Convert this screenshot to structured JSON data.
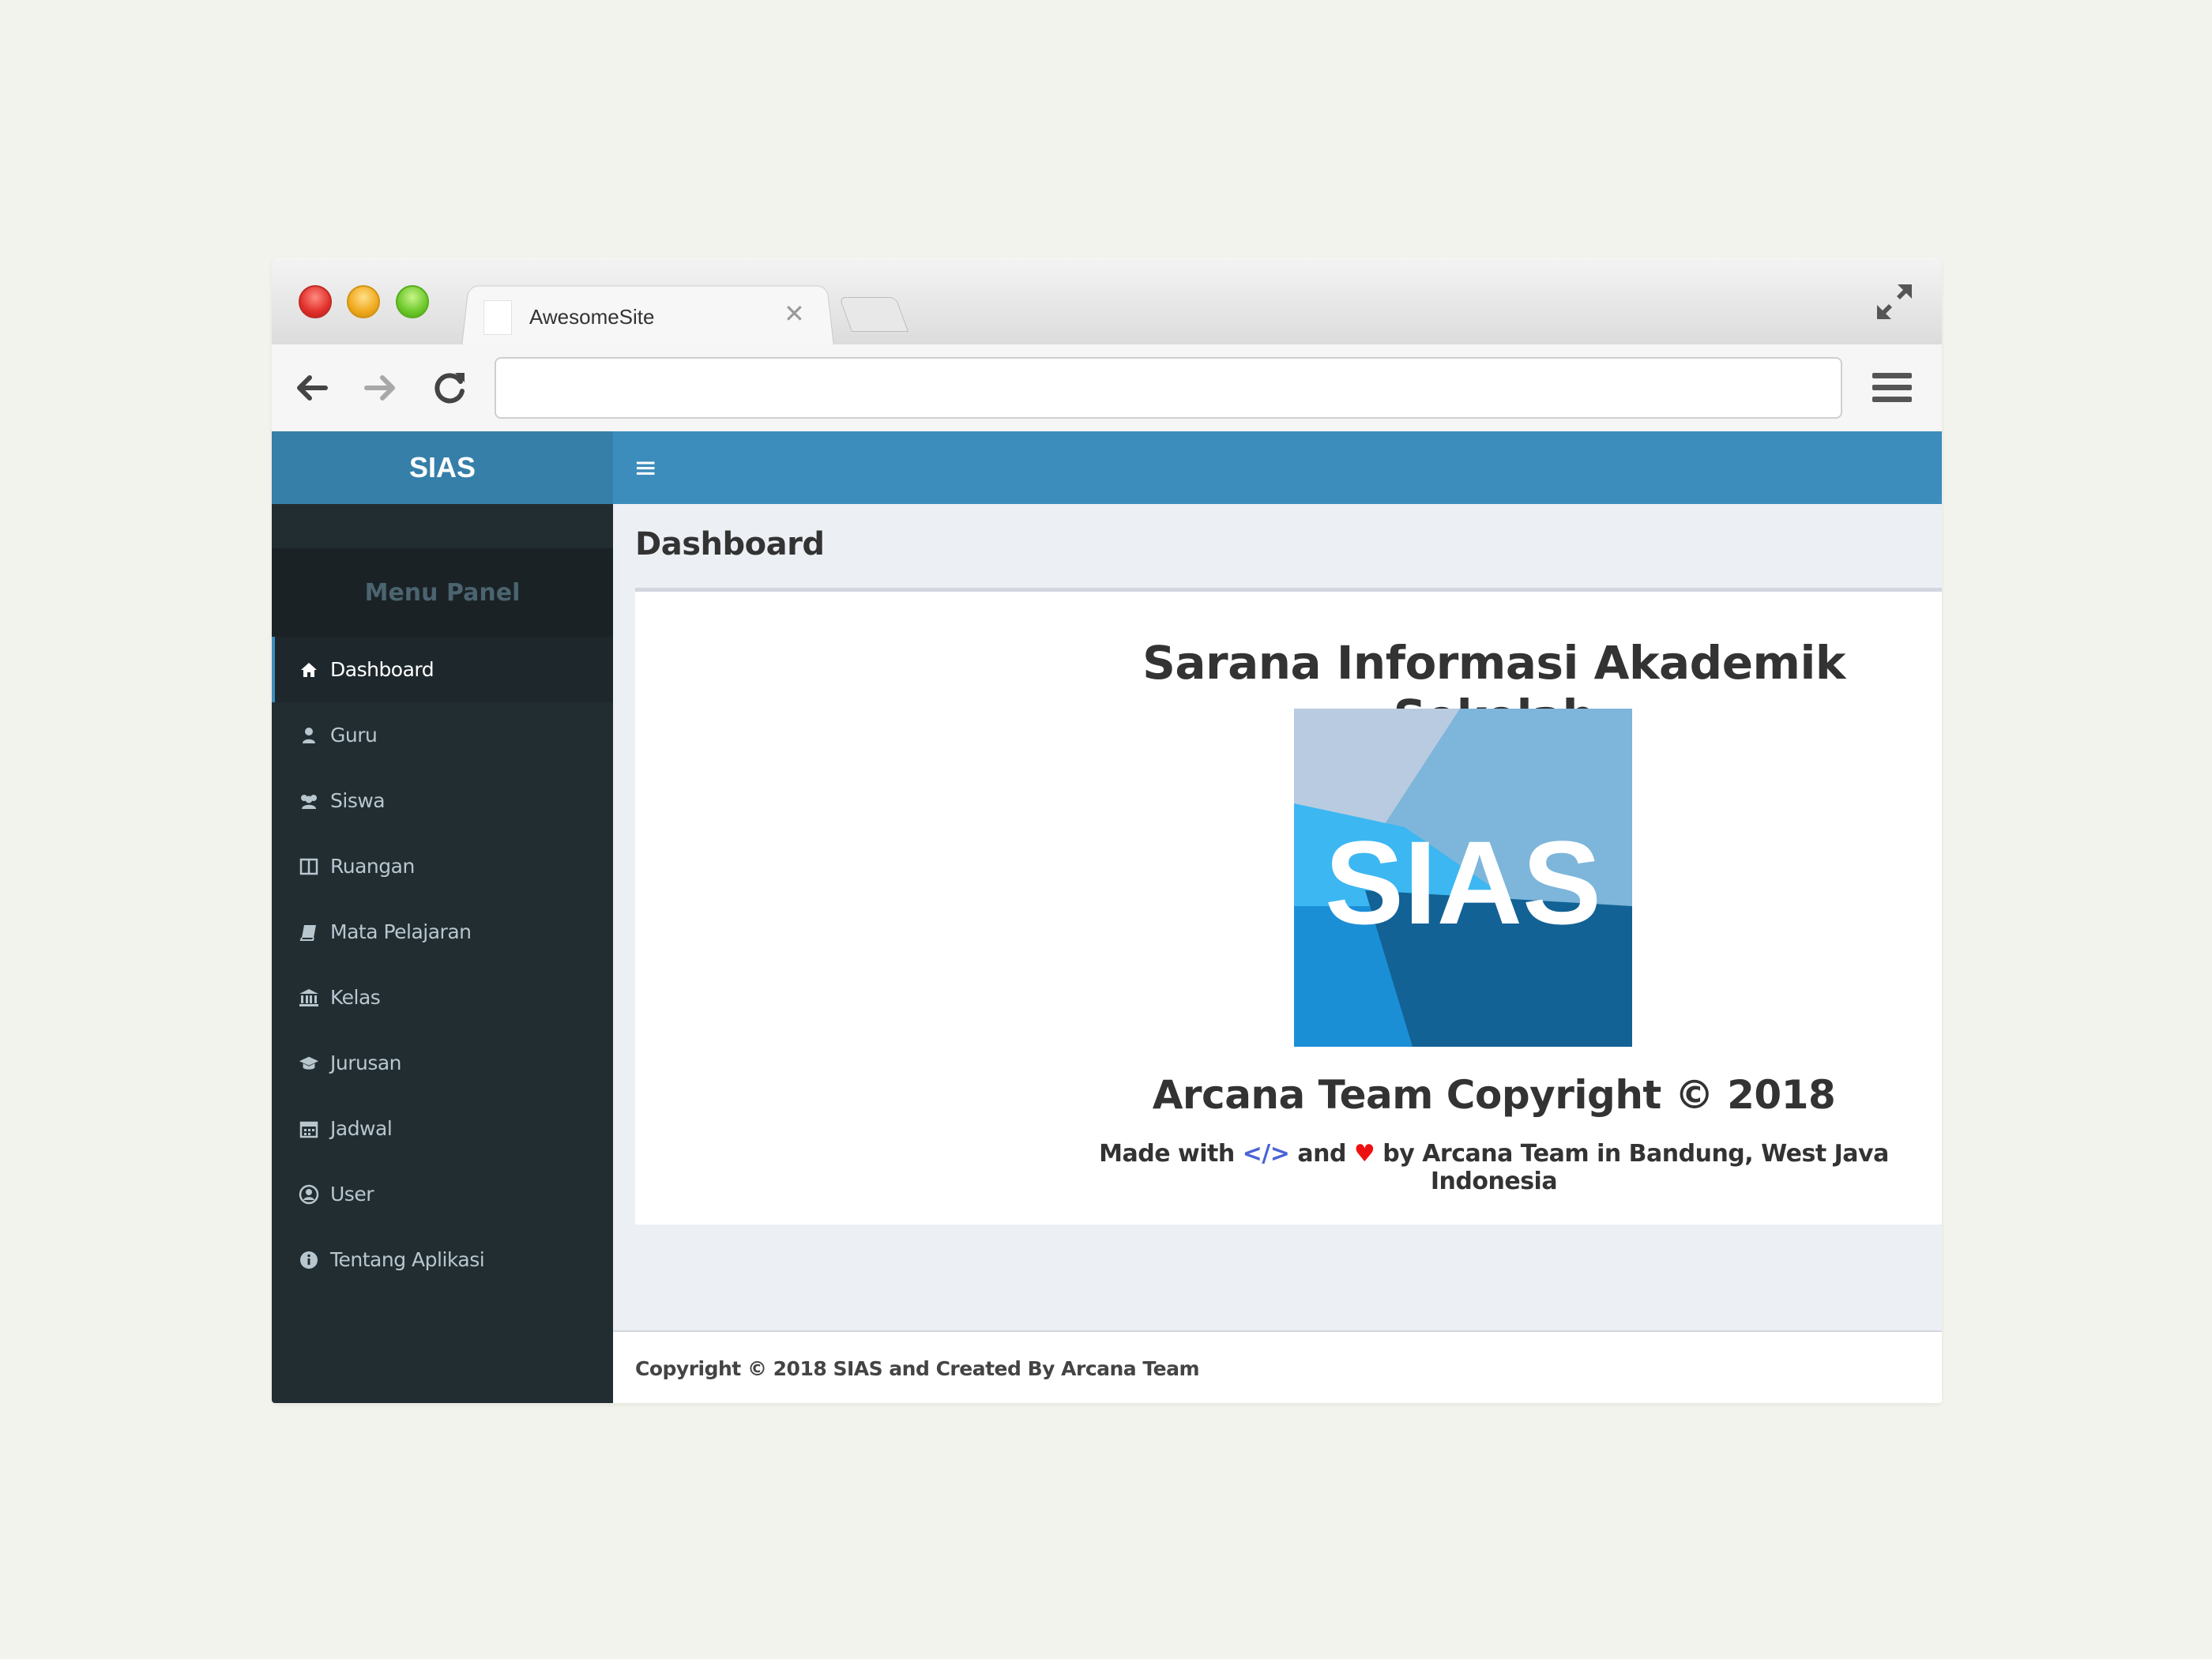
{
  "browser": {
    "tab_title": "AwesomeSite",
    "tab_close": "✕",
    "url": ""
  },
  "app": {
    "brand": "SIAS",
    "menu_toggle": "≡"
  },
  "sidebar": {
    "header": "Menu Panel",
    "items": [
      {
        "label": "Dashboard",
        "icon": "home-icon",
        "active": true
      },
      {
        "label": "Guru",
        "icon": "user-icon"
      },
      {
        "label": "Siswa",
        "icon": "users-icon"
      },
      {
        "label": "Ruangan",
        "icon": "columns-icon"
      },
      {
        "label": "Mata Pelajaran",
        "icon": "book-icon"
      },
      {
        "label": "Kelas",
        "icon": "institution-icon"
      },
      {
        "label": "Jurusan",
        "icon": "graduation-cap-icon"
      },
      {
        "label": "Jadwal",
        "icon": "calendar-icon"
      },
      {
        "label": "User",
        "icon": "user-circle-icon"
      },
      {
        "label": "Tentang Aplikasi",
        "icon": "info-circle-icon"
      }
    ]
  },
  "main": {
    "page_title": "Dashboard",
    "hero_title": "Sarana Informasi Akademik Sekolah",
    "logo_text": "SIAS",
    "copyright_title": "Arcana Team Copyright © 2018",
    "made_prefix": "Made with",
    "made_code": "</>",
    "made_and": "and",
    "made_heart": "♥",
    "made_suffix": "by Arcana Team in Bandung, West Java Indonesia"
  },
  "footer": {
    "text": "Copyright © 2018 SIAS and Created By Arcana Team"
  },
  "colors": {
    "header_blue": "#3c8dbc",
    "brand_blue": "#367fa9",
    "sidebar_dark": "#222d32",
    "content_bg": "#ecf0f5"
  }
}
